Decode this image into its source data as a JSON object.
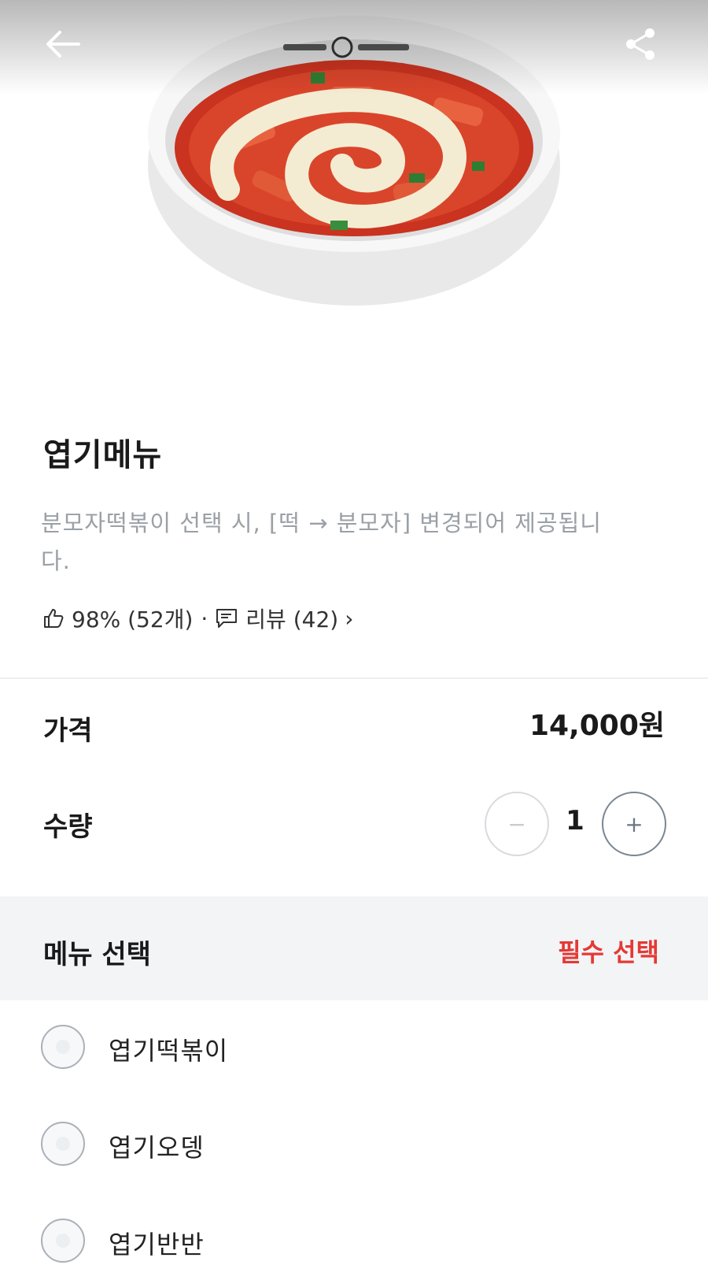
{
  "header": {
    "back_icon": "arrow-left-icon",
    "share_icon": "share-icon",
    "image_subject": "bowl of spicy tteokbokki with cheese"
  },
  "product": {
    "title": "엽기메뉴",
    "description": "분모자떡볶이 선택 시, [떡 → 분모자] 변경되어 제공됩니다.",
    "rating": "98% (52개)",
    "dot": "·",
    "review_label": "리뷰 (42)",
    "chevron": "›"
  },
  "price": {
    "label": "가격",
    "value": "14,000원"
  },
  "quantity": {
    "label": "수량",
    "value": "1",
    "minus": "−",
    "plus": "+"
  },
  "menu_select": {
    "title": "메뉴 선택",
    "required": "필수 선택",
    "options": [
      {
        "label": "엽기떡볶이"
      },
      {
        "label": "엽기오뎅"
      },
      {
        "label": "엽기반반"
      }
    ]
  },
  "colors": {
    "required_red": "#e53935",
    "section_bg": "#f2f4f6",
    "muted_text": "#9aa0a6"
  }
}
